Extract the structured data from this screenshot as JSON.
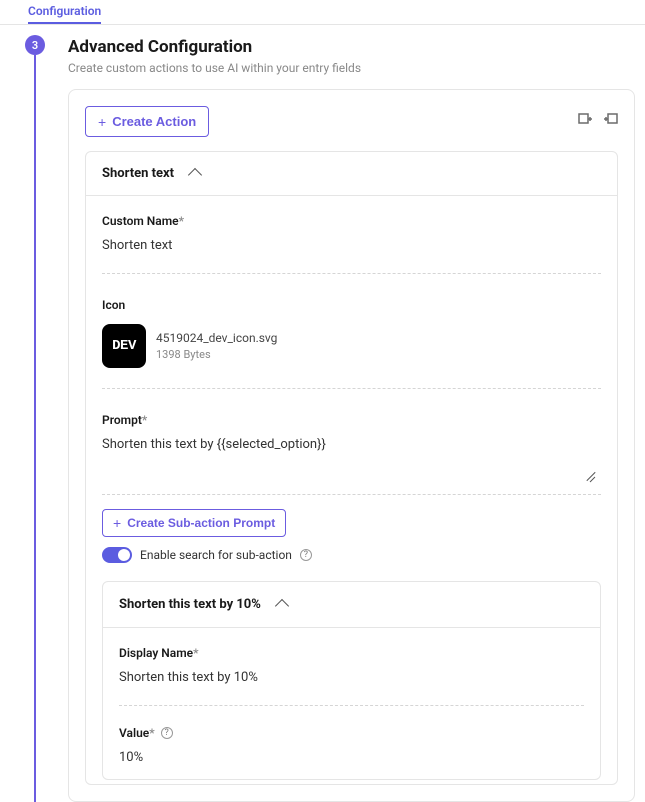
{
  "tab": {
    "label": "Configuration"
  },
  "step": {
    "number": "3"
  },
  "section": {
    "title": "Advanced Configuration",
    "subtitle": "Create custom actions to use AI within your entry fields"
  },
  "buttons": {
    "create_action": "Create Action",
    "create_subaction": "Create Sub-action Prompt"
  },
  "action": {
    "header": "Shorten text",
    "custom_name": {
      "label": "Custom Name",
      "value": "Shorten text"
    },
    "icon": {
      "label": "Icon",
      "filename": "4519024_dev_icon.svg",
      "size": "1398 Bytes",
      "badge": "DEV"
    },
    "prompt": {
      "label": "Prompt",
      "value": "Shorten this text by {{selected_option}}"
    },
    "enable_search": {
      "label": "Enable search for sub-action"
    }
  },
  "subaction": {
    "header": "Shorten this text by 10%",
    "display_name": {
      "label": "Display Name",
      "value": "Shorten this text by 10%"
    },
    "value": {
      "label": "Value",
      "value": "10%"
    }
  }
}
